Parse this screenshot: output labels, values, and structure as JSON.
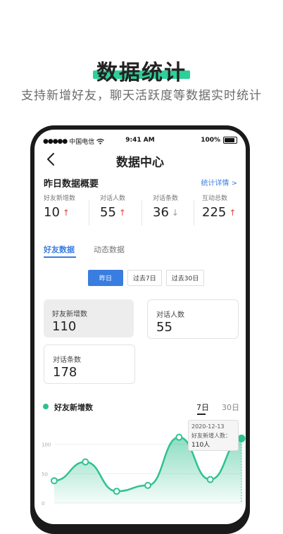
{
  "hero": {
    "title": "数据统计",
    "subtitle": "支持新增好友，聊天活跃度等数据实时统计"
  },
  "status_bar": {
    "carrier": "中国电信",
    "time": "9:41 AM",
    "battery": "100%"
  },
  "nav": {
    "title": "数据中心"
  },
  "overview": {
    "title": "昨日数据概要",
    "link": "统计详情 >",
    "stats": [
      {
        "label": "好友新增数",
        "value": "10",
        "trend": "up"
      },
      {
        "label": "对话人数",
        "value": "55",
        "trend": "up"
      },
      {
        "label": "对话条数",
        "value": "36",
        "trend": "down"
      },
      {
        "label": "互动总数",
        "value": "225",
        "trend": "up"
      }
    ],
    "arrow_up": "↑",
    "arrow_down": "↓"
  },
  "tabs": {
    "active": "好友数据",
    "inactive": "动态数据"
  },
  "segments": {
    "items": [
      "昨日",
      "过去7日",
      "过去30日"
    ],
    "selected": "昨日"
  },
  "cards": [
    {
      "label": "好友新增数",
      "value": "110",
      "selected": true
    },
    {
      "label": "对话人数",
      "value": "55",
      "selected": false
    },
    {
      "label": "对话条数",
      "value": "178",
      "selected": false
    }
  ],
  "chart_header": {
    "title": "好友新增数",
    "range_7": "7日",
    "range_30": "30日",
    "selected_range": "7日"
  },
  "tooltip": {
    "date": "2020-12-13",
    "label": "好友新增人数：",
    "value": "110人"
  },
  "colors": {
    "accent_green": "#2fc28f",
    "brand_blue": "#3a7de0",
    "hero_underline": "#2ecf9a",
    "trend_up": "#e3463c"
  },
  "chart_data": {
    "type": "area",
    "title": "",
    "xlabel": "",
    "ylabel": "",
    "ylim": [
      0,
      120
    ],
    "y_ticks": [
      "100",
      "50",
      "0"
    ],
    "series": [
      {
        "name": "好友新增数",
        "values": [
          38,
          70,
          20,
          30,
          112,
          40,
          110
        ]
      }
    ],
    "highlight_index": 6,
    "grid": true
  }
}
